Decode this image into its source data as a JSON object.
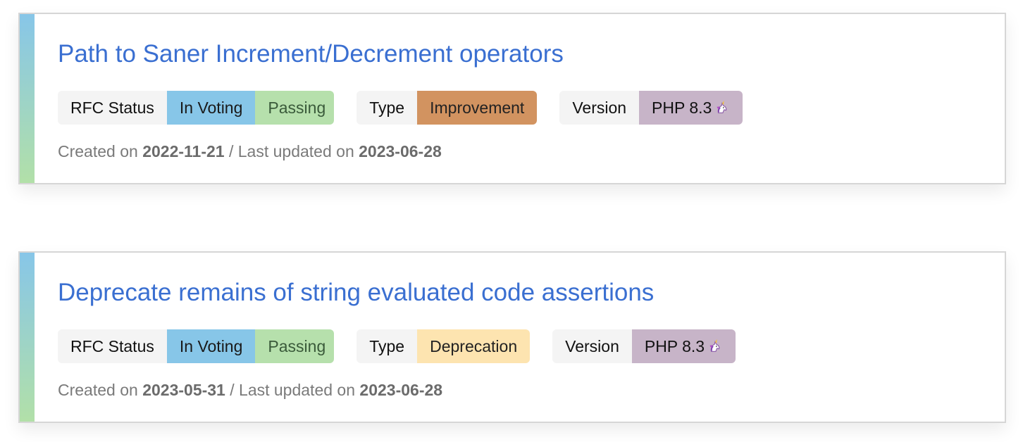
{
  "rfcs": [
    {
      "title": "Path to Saner Increment/Decrement operators",
      "status_label": "RFC Status",
      "status": "In Voting",
      "vote_result": "Passing",
      "type_label": "Type",
      "type": "Improvement",
      "version_label": "Version",
      "version": "PHP 8.3",
      "version_icon": "unicorn-icon",
      "created_prefix": "Created on",
      "created": "2022-11-21",
      "updated_prefix": "/ Last updated on",
      "updated": "2023-06-28"
    },
    {
      "title": "Deprecate remains of string evaluated code assertions",
      "status_label": "RFC Status",
      "status": "In Voting",
      "vote_result": "Passing",
      "type_label": "Type",
      "type": "Deprecation",
      "version_label": "Version",
      "version": "PHP 8.3",
      "version_icon": "unicorn-icon",
      "created_prefix": "Created on",
      "created": "2023-05-31",
      "updated_prefix": "/ Last updated on",
      "updated": "2023-06-28"
    }
  ],
  "colors": {
    "title_link": "#3a6fd1",
    "status_voting": "#87c6e8",
    "status_passing": "#b6e0ac",
    "type_improvement": "#d29360",
    "type_deprecation": "#fde4b0",
    "version": "#c7b4c8",
    "badge_label": "#f4f4f4",
    "meta_text": "#7a7a7a"
  }
}
